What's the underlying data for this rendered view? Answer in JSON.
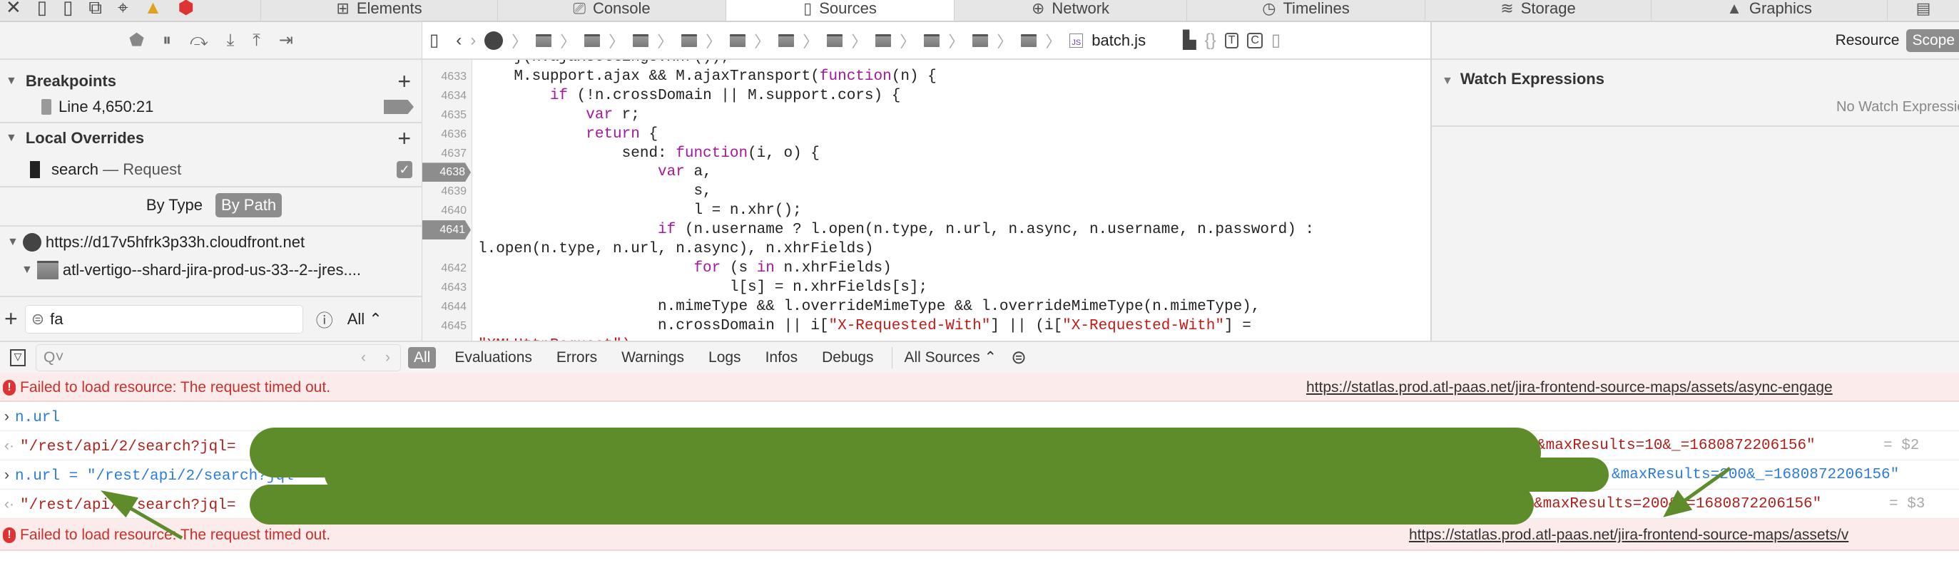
{
  "tabs": [
    {
      "label": "Elements",
      "icon": "elements-icon"
    },
    {
      "label": "Console",
      "icon": "console-icon"
    },
    {
      "label": "Sources",
      "icon": "file-icon",
      "selected": true
    },
    {
      "label": "Network",
      "icon": "network-icon"
    },
    {
      "label": "Timelines",
      "icon": "clock-icon"
    },
    {
      "label": "Storage",
      "icon": "storage-icon"
    },
    {
      "label": "Graphics",
      "icon": "graphics-icon"
    },
    {
      "label": "",
      "icon": "layers-icon"
    }
  ],
  "sidebar": {
    "breakpoints": {
      "title": "Breakpoints",
      "item": "Line 4,650:21"
    },
    "overrides": {
      "title": "Local Overrides",
      "item_name": "search",
      "item_type": "— Request",
      "checked": true
    },
    "group": {
      "by_type": "By Type",
      "by_path": "By Path"
    },
    "tree": {
      "host": "https://d17v5hfrk3p33h.cloudfront.net",
      "folder": "atl-vertigo--shard-jira-prod-us-33--2--jres...."
    },
    "filter": {
      "value": "fa",
      "scope": "All"
    }
  },
  "source": {
    "filename": "batch.js",
    "crumb_folders": 11,
    "lines": [
      {
        "n": "",
        "t": [
          [
            "    }(n.ajaxSettings.xhr());",
            ""
          ]
        ]
      },
      {
        "n": "4633",
        "t": [
          [
            "    M.support.ajax && M.ajaxTransport(",
            ""
          ],
          [
            "function",
            "kw"
          ],
          [
            "(n) {",
            ""
          ]
        ]
      },
      {
        "n": "4634",
        "t": [
          [
            "        ",
            ""
          ],
          [
            "if",
            "kw"
          ],
          [
            " (!n.crossDomain || M.support.cors) {",
            ""
          ]
        ]
      },
      {
        "n": "4635",
        "t": [
          [
            "            ",
            ""
          ],
          [
            "var",
            "kw"
          ],
          [
            " r;",
            ""
          ]
        ]
      },
      {
        "n": "4636",
        "t": [
          [
            "            ",
            ""
          ],
          [
            "return",
            "kw"
          ],
          [
            " {",
            ""
          ]
        ]
      },
      {
        "n": "4637",
        "t": [
          [
            "                send: ",
            ""
          ],
          [
            "function",
            "kw"
          ],
          [
            "(i, o) {",
            ""
          ]
        ]
      },
      {
        "n": "4638",
        "bp": true,
        "t": [
          [
            "                    ",
            ""
          ],
          [
            "var",
            "kw"
          ],
          [
            " a,",
            ""
          ]
        ]
      },
      {
        "n": "4639",
        "t": [
          [
            "                        s,",
            ""
          ]
        ]
      },
      {
        "n": "4640",
        "t": [
          [
            "                        l = n.xhr();",
            ""
          ]
        ]
      },
      {
        "n": "4641",
        "bp": true,
        "t": [
          [
            "                    ",
            ""
          ],
          [
            "if",
            "kw"
          ],
          [
            " (n.username ? l.open(n.type, n.url, n.async, n.username, n.password) :",
            ""
          ]
        ]
      },
      {
        "n": "",
        "t": [
          [
            "l.open(n.type, n.url, n.async), n.xhrFields)",
            ""
          ]
        ]
      },
      {
        "n": "4642",
        "t": [
          [
            "                        ",
            ""
          ],
          [
            "for",
            "kw"
          ],
          [
            " (s ",
            ""
          ],
          [
            "in",
            "kw"
          ],
          [
            " n.xhrFields)",
            ""
          ]
        ]
      },
      {
        "n": "4643",
        "t": [
          [
            "                            l[s] = n.xhrFields[s];",
            ""
          ]
        ]
      },
      {
        "n": "4644",
        "t": [
          [
            "                    n.mimeType && l.overrideMimeType && l.overrideMimeType(n.mimeType),",
            ""
          ]
        ]
      },
      {
        "n": "4645",
        "t": [
          [
            "                    n.crossDomain || i[",
            ""
          ],
          [
            "\"X-Requested-With\"",
            "str"
          ],
          [
            "] || (i[",
            ""
          ],
          [
            "\"X-Requested-With\"",
            "str"
          ],
          [
            "] =",
            ""
          ]
        ]
      },
      {
        "n": "",
        "t": [
          [
            "\"XMLHttpRequest\"),",
            "str"
          ]
        ]
      }
    ]
  },
  "details": {
    "resource": "Resource",
    "scope": "Scope",
    "watch_title": "Watch Expressions",
    "watch_empty": "No Watch Expressions"
  },
  "console": {
    "filters": [
      "All",
      "Evaluations",
      "Errors",
      "Warnings",
      "Logs",
      "Infos",
      "Debugs"
    ],
    "sources": "All Sources",
    "err1": {
      "msg": "Failed to load resource: The request timed out.",
      "url": "https://statlas.prod.atl-paas.net/jira-frontend-source-maps/assets/async-engage"
    },
    "in1": "n.url",
    "out1": {
      "prefix": "\"/rest/api/2/search?jql=",
      "suffix": "&maxResults=10&_=1680872206156\"",
      "ref": "= $2"
    },
    "in2": {
      "prefix": "n.url = \"/rest/api/2/search?jql=",
      "suffix": "&maxResults=200&_=1680872206156\""
    },
    "out2": {
      "prefix": "\"/rest/api/2/search?jql=",
      "suffix": "&maxResults=200&_=1680872206156\"",
      "ref": "= $3"
    },
    "err2": {
      "msg": "Failed to load resource: The request timed out.",
      "url": "https://statlas.prod.atl-paas.net/jira-frontend-source-maps/assets/v"
    }
  },
  "colors": {
    "redaction": "#5f8c2a",
    "keyword": "#a6169e",
    "string": "#c41a16",
    "error_bg": "#fcebeb"
  }
}
